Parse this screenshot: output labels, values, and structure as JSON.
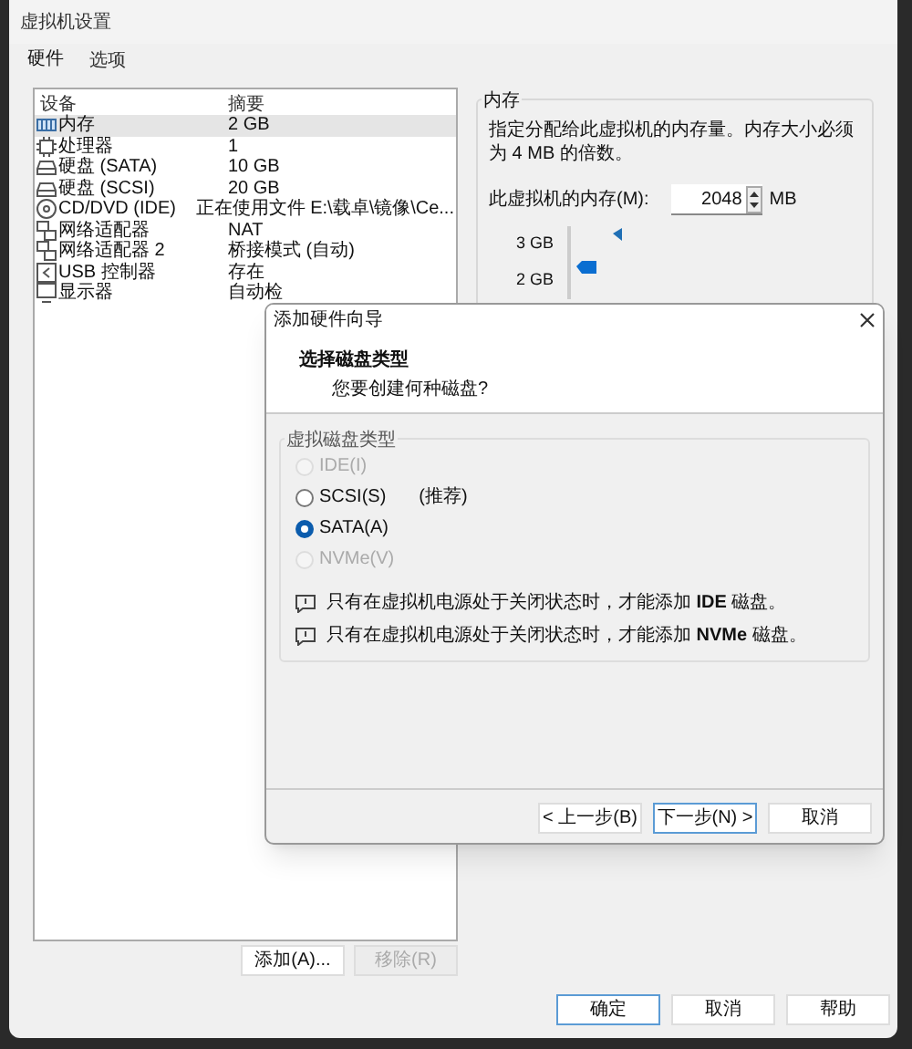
{
  "window": {
    "title": "虚拟机设置"
  },
  "tabs": [
    {
      "label": "硬件",
      "selected": true
    },
    {
      "label": "选项",
      "selected": false
    }
  ],
  "device_table": {
    "columns": [
      "设备",
      "摘要"
    ],
    "rows": [
      {
        "kind": "memory",
        "device": "内存",
        "summary": "2 GB",
        "selected": true
      },
      {
        "kind": "cpu",
        "device": "处理器",
        "summary": "1",
        "selected": false
      },
      {
        "kind": "disk",
        "device": "硬盘 (SATA)",
        "summary": "10 GB",
        "selected": false
      },
      {
        "kind": "disk",
        "device": "硬盘 (SCSI)",
        "summary": "20 GB",
        "selected": false
      },
      {
        "kind": "cd",
        "device": "CD/DVD (IDE)",
        "summary": "正在使用文件 E:\\载卓\\镜像\\Ce...",
        "selected": false
      },
      {
        "kind": "network",
        "device": "网络适配器",
        "summary": "NAT",
        "selected": false
      },
      {
        "kind": "network",
        "device": "网络适配器 2",
        "summary": "桥接模式 (自动)",
        "selected": false
      },
      {
        "kind": "usb",
        "device": "USB 控制器",
        "summary": "存在",
        "selected": false
      },
      {
        "kind": "monitor",
        "device": "显示器",
        "summary": "自动检",
        "selected": false
      }
    ]
  },
  "list_buttons": [
    {
      "label": "添加(A)...",
      "disabled": false
    },
    {
      "label": "移除(R)",
      "disabled": true
    }
  ],
  "memory": {
    "group_title": "内存",
    "description": "指定分配给此虚拟机的内存量。内存大小必须为 4 MB 的倍数。",
    "field_label": "此虚拟机的内存(M):",
    "value": "2048",
    "unit": "MB",
    "scale_labels": [
      "3 GB",
      "2 GB"
    ]
  },
  "dialog": {
    "title": "添加硬件向导",
    "heading": "选择磁盘类型",
    "subheading": "您要创建何种磁盘?",
    "group_title": "虚拟磁盘类型",
    "options": [
      {
        "label": "IDE(I)",
        "selected": false,
        "disabled": true
      },
      {
        "label": "SCSI(S)",
        "note": "(推荐)",
        "selected": false,
        "disabled": false
      },
      {
        "label": "SATA(A)",
        "selected": true,
        "disabled": false
      },
      {
        "label": "NVMe(V)",
        "selected": false,
        "disabled": true
      }
    ],
    "notes": [
      "只有在虚拟机电源处于关闭状态时，才能添加 **IDE** 磁盘。",
      "只有在虚拟机电源处于关闭状态时，才能添加 **NVMe** 磁盘。"
    ],
    "buttons": [
      {
        "label": "< 上一步(B)",
        "default": false
      },
      {
        "label": "下一步(N) >",
        "default": true
      },
      {
        "label": "取消",
        "default": false
      }
    ]
  },
  "buttons": [
    {
      "label": "确定",
      "default": true
    },
    {
      "label": "取消",
      "default": false
    },
    {
      "label": "帮助",
      "default": false
    }
  ]
}
